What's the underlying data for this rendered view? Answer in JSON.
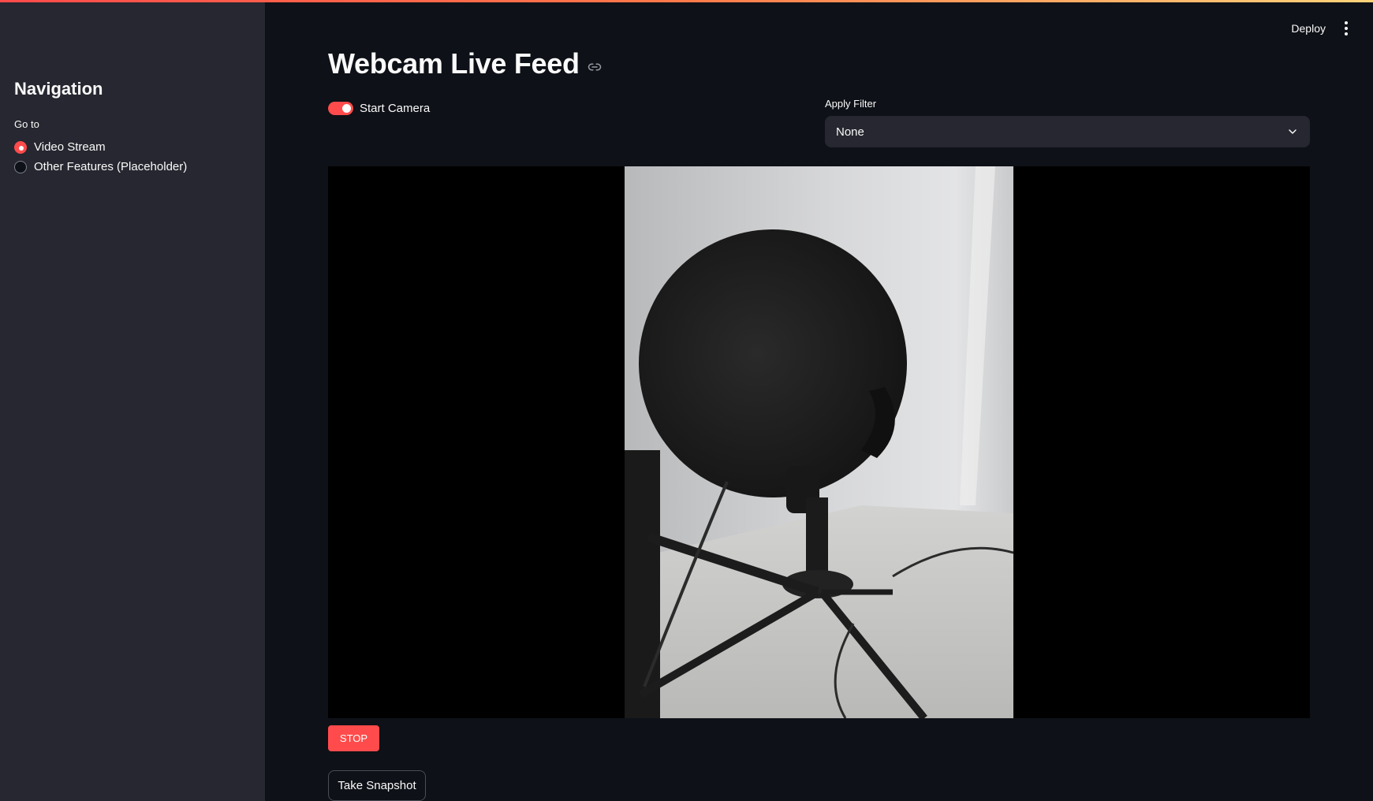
{
  "sidebar": {
    "title": "Navigation",
    "radio_label": "Go to",
    "options": [
      {
        "label": "Video Stream",
        "selected": true
      },
      {
        "label": "Other Features (Placeholder)",
        "selected": false
      }
    ]
  },
  "header": {
    "deploy_label": "Deploy",
    "menu_icon": "kebab-menu-icon"
  },
  "main": {
    "title": "Webcam Live Feed",
    "title_anchor_icon": "link-icon",
    "camera_toggle": {
      "label": "Start Camera",
      "checked": true
    },
    "filter": {
      "label": "Apply Filter",
      "value": "None",
      "icon": "chevron-down-icon"
    },
    "video": {
      "content": "webcam frame: grayscale microphone on tripod stand"
    },
    "stop_label": "STOP",
    "snapshot_label": "Take Snapshot"
  },
  "colors": {
    "background": "#0e1117",
    "sidebar": "#262730",
    "accent": "#ff4b4b",
    "text": "#fafafa"
  }
}
